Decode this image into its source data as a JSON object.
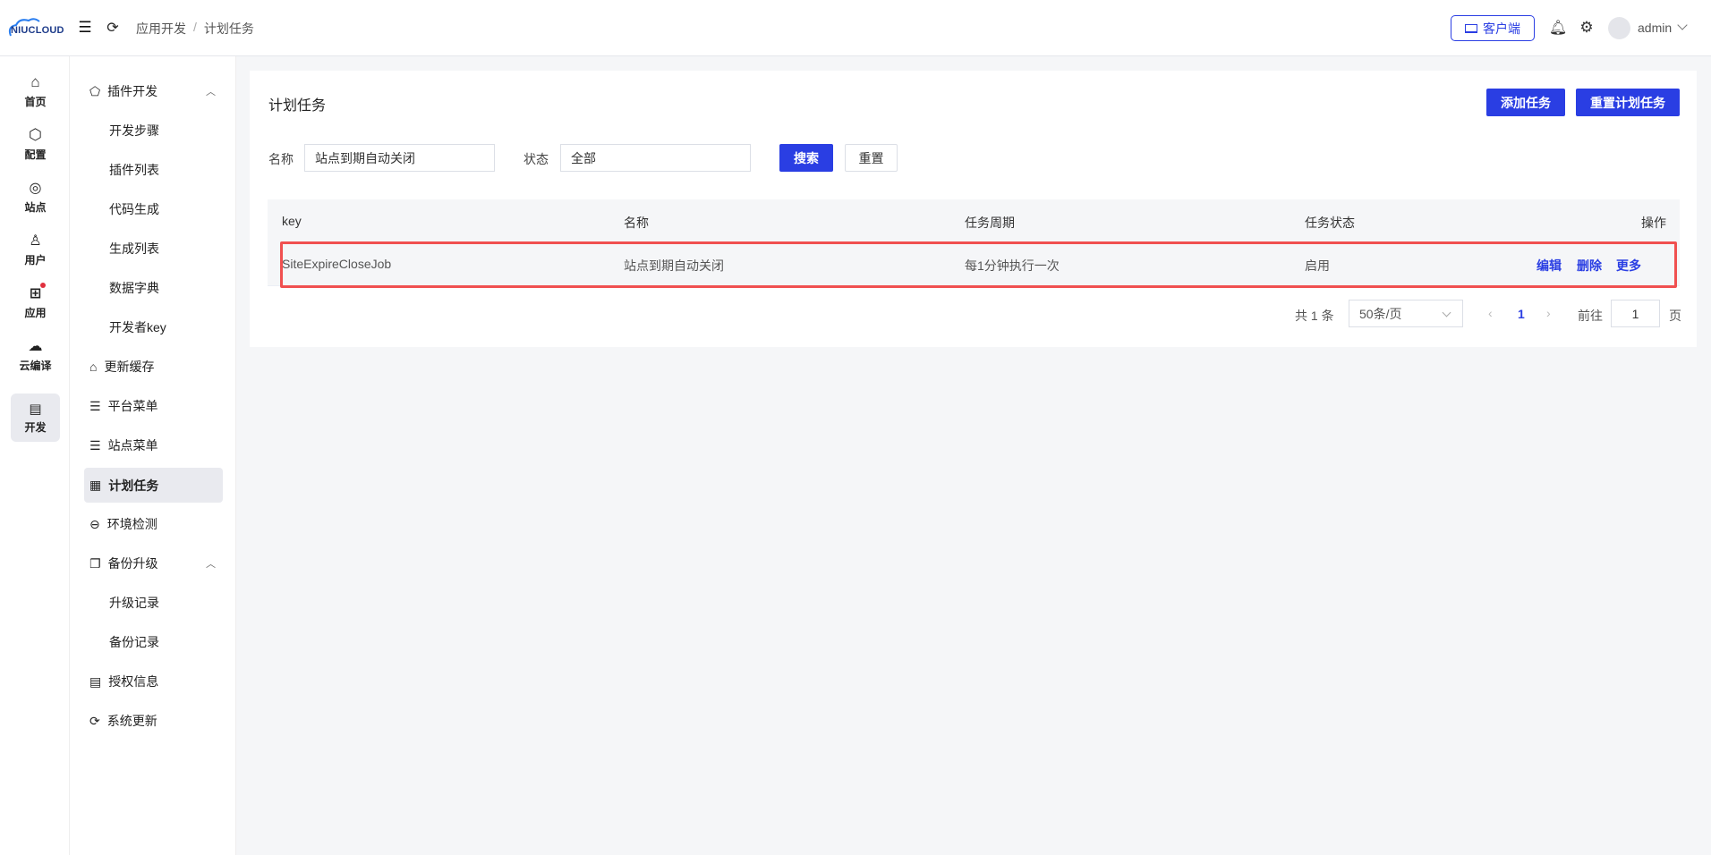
{
  "header": {
    "logo": "NIUCLOUD",
    "breadcrumb": [
      "应用开发",
      "计划任务"
    ],
    "breadcrumb_sep": "/",
    "client_button": "客户端",
    "user": "admin"
  },
  "rail": [
    {
      "label": "首页",
      "icon": "home-icon"
    },
    {
      "label": "配置",
      "icon": "settings-hex-icon"
    },
    {
      "label": "站点",
      "icon": "location-icon"
    },
    {
      "label": "用户",
      "icon": "user-icon"
    },
    {
      "label": "应用",
      "icon": "apps-icon"
    },
    {
      "label": "云编译",
      "icon": "cloud-icon"
    },
    {
      "label": "开发",
      "icon": "code-window-icon",
      "active": true
    }
  ],
  "sidebar": [
    {
      "label": "插件开发",
      "icon": "plugin-icon",
      "expanded": true
    },
    {
      "label": "开发步骤",
      "sub": true
    },
    {
      "label": "插件列表",
      "sub": true
    },
    {
      "label": "代码生成",
      "sub": true
    },
    {
      "label": "生成列表",
      "sub": true
    },
    {
      "label": "数据字典",
      "sub": true
    },
    {
      "label": "开发者key",
      "sub": true
    },
    {
      "label": "更新缓存",
      "icon": "cache-icon"
    },
    {
      "label": "平台菜单",
      "icon": "list-icon"
    },
    {
      "label": "站点菜单",
      "icon": "list-icon"
    },
    {
      "label": "计划任务",
      "icon": "calendar-icon",
      "active": true
    },
    {
      "label": "环境检测",
      "icon": "check-icon"
    },
    {
      "label": "备份升级",
      "icon": "copy-icon",
      "expanded": true
    },
    {
      "label": "升级记录",
      "sub": true
    },
    {
      "label": "备份记录",
      "sub": true
    },
    {
      "label": "授权信息",
      "icon": "doc-icon"
    },
    {
      "label": "系统更新",
      "icon": "refresh-icon"
    }
  ],
  "page": {
    "title": "计划任务",
    "add_button": "添加任务",
    "reset_tasks_button": "重置计划任务"
  },
  "filters": {
    "name_label": "名称",
    "name_value": "站点到期自动关闭",
    "status_label": "状态",
    "status_value": "全部",
    "search_button": "搜索",
    "reset_button": "重置"
  },
  "table": {
    "columns": [
      "key",
      "名称",
      "任务周期",
      "任务状态",
      "操作"
    ],
    "rows": [
      {
        "key": "SiteExpireCloseJob",
        "name": "站点到期自动关闭",
        "period": "每1分钟执行一次",
        "status": "启用",
        "actions": [
          "编辑",
          "删除",
          "更多"
        ]
      }
    ]
  },
  "pagination": {
    "total": "共 1 条",
    "page_size": "50条/页",
    "current": "1",
    "goto_label": "前往",
    "goto_value": "1",
    "page_suffix": "页"
  },
  "colors": {
    "primary": "#2a3ee3",
    "highlight": "#f05050"
  }
}
